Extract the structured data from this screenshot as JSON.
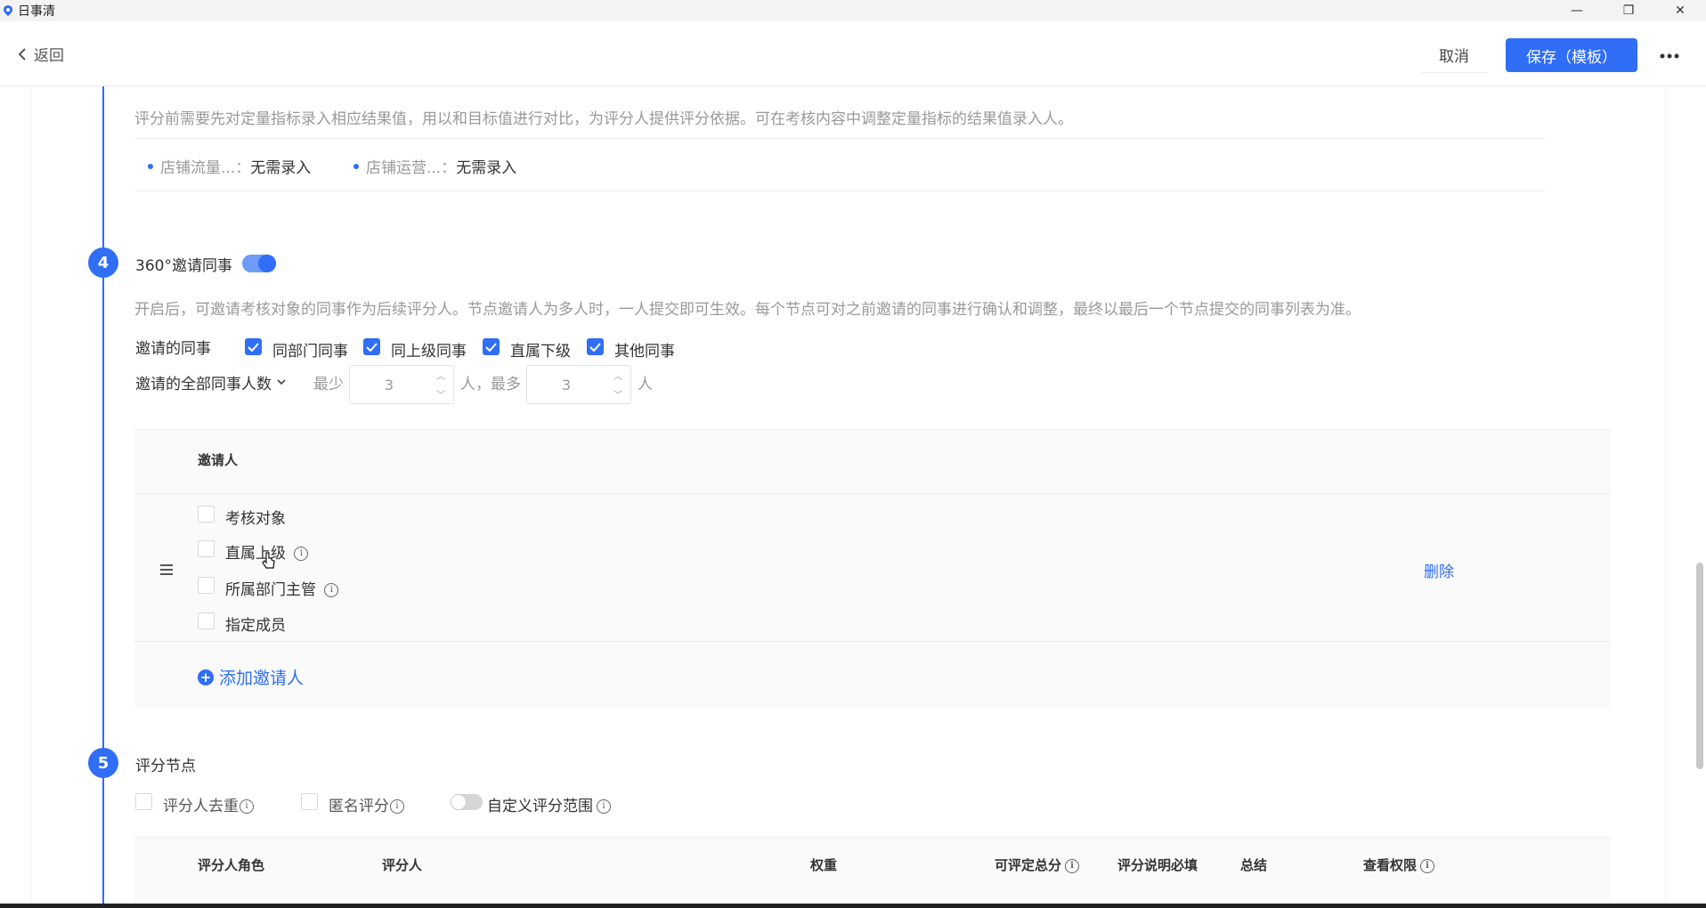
{
  "window": {
    "title": "日事清",
    "controls": {
      "minimize": "—",
      "restore": "❐",
      "close": "✕"
    }
  },
  "header": {
    "back_label": "返回",
    "cancel_label": "取消",
    "save_label": "保存（模板）",
    "more_label": "⋯"
  },
  "section3": {
    "description": "评分前需要先对定量指标录入相应结果值，用以和目标值进行对比，为评分人提供评分依据。可在考核内容中调整定量指标的结果值录入人。",
    "items": [
      {
        "label": "店铺流量...",
        "sep": "：",
        "value": "无需录入"
      },
      {
        "label": "店铺运营...",
        "sep": "：",
        "value": "无需录入"
      }
    ]
  },
  "section4": {
    "number": "4",
    "title": "360°邀请同事",
    "toggle_on": true,
    "description": "开启后，可邀请考核对象的同事作为后续评分人。节点邀请人为多人时，一人提交即可生效。每个节点可对之前邀请的同事进行确认和调整，最终以最后一个节点提交的同事列表为准。",
    "colleagues_label": "邀请的同事",
    "colleague_options": [
      {
        "label": "同部门同事",
        "checked": true
      },
      {
        "label": "同上级同事",
        "checked": true
      },
      {
        "label": "直属下级",
        "checked": true
      },
      {
        "label": "其他同事",
        "checked": true
      }
    ],
    "count_label": "邀请的全部同事人数",
    "min_label": "最少",
    "min_value": "3",
    "unit_mid": "人，最多",
    "max_value": "3",
    "unit_end": "人",
    "inviter_header": "邀请人",
    "inviter_options": [
      {
        "label": "考核对象",
        "info": false
      },
      {
        "label": "直属上级",
        "info": true
      },
      {
        "label": "所属部门主管",
        "info": true
      },
      {
        "label": "指定成员",
        "info": false
      }
    ],
    "delete_label": "删除",
    "add_inviter_label": "添加邀请人"
  },
  "section5": {
    "number": "5",
    "title": "评分节点",
    "options": {
      "dedupe": "评分人去重",
      "anonymous": "匿名评分",
      "custom_range": "自定义评分范围"
    },
    "columns": [
      "评分人角色",
      "评分人",
      "权重",
      "可评定总分",
      "评分说明必填",
      "总结",
      "查看权限"
    ]
  },
  "icons": {
    "info_glyph": "i"
  }
}
